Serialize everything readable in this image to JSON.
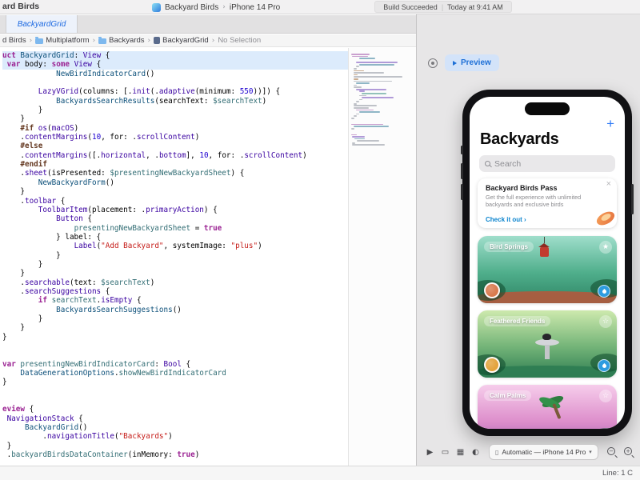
{
  "window": {
    "title": "ard Birds"
  },
  "toolbar": {
    "scheme": {
      "app": "Backyard Birds",
      "separator": "›",
      "device": "iPhone 14 Pro"
    },
    "status": {
      "build": "Build Succeeded",
      "divider": "|",
      "time": "Today at 9:41 AM"
    }
  },
  "tabs": [
    {
      "label": "BackyardGrid"
    }
  ],
  "breadcrumb": {
    "separator": "›",
    "items": [
      "d Birds",
      "Multiplatform",
      "Backyards",
      "BackyardGrid",
      "No Selection"
    ]
  },
  "editor": {
    "highlighted_lines": [
      0,
      1
    ],
    "code": [
      [
        [
          "k",
          "uct"
        ],
        [
          "p",
          " "
        ],
        [
          "ty",
          "BackyardGrid"
        ],
        [
          "p",
          ": "
        ],
        [
          "fw",
          "View"
        ],
        [
          "p",
          " {"
        ]
      ],
      [
        [
          "p",
          " "
        ],
        [
          "k",
          "var"
        ],
        [
          "p",
          " body: "
        ],
        [
          "k",
          "some"
        ],
        [
          "p",
          " "
        ],
        [
          "fw",
          "View"
        ],
        [
          "p",
          " {"
        ]
      ],
      [
        [
          "p",
          "            "
        ],
        [
          "ty",
          "NewBirdIndicatorCard"
        ],
        [
          "p",
          "()"
        ]
      ],
      [],
      [
        [
          "p",
          "        "
        ],
        [
          "fw",
          "LazyVGrid"
        ],
        [
          "p",
          "(columns: [."
        ],
        [
          "fw",
          "init"
        ],
        [
          "p",
          "(."
        ],
        [
          "fw",
          "adaptive"
        ],
        [
          "p",
          "(minimum: "
        ],
        [
          "n",
          "550"
        ],
        [
          "p",
          "))]) {"
        ]
      ],
      [
        [
          "p",
          "            "
        ],
        [
          "ty",
          "BackyardsSearchResults"
        ],
        [
          "p",
          "(searchText: "
        ],
        [
          "v",
          "$searchText"
        ],
        [
          "p",
          ")"
        ]
      ],
      [
        [
          "p",
          "        }"
        ]
      ],
      [
        [
          "p",
          "    }"
        ]
      ],
      [
        [
          "p",
          "    "
        ],
        [
          "pp",
          "#if"
        ],
        [
          "p",
          " "
        ],
        [
          "fw",
          "os"
        ],
        [
          "p",
          "("
        ],
        [
          "fw",
          "macOS"
        ],
        [
          "p",
          ")"
        ]
      ],
      [
        [
          "p",
          "    ."
        ],
        [
          "fw",
          "contentMargins"
        ],
        [
          "p",
          "("
        ],
        [
          "n",
          "10"
        ],
        [
          "p",
          ", for: ."
        ],
        [
          "fw",
          "scrollContent"
        ],
        [
          "p",
          ")"
        ]
      ],
      [
        [
          "p",
          "    "
        ],
        [
          "pp",
          "#else"
        ]
      ],
      [
        [
          "p",
          "    ."
        ],
        [
          "fw",
          "contentMargins"
        ],
        [
          "p",
          "([."
        ],
        [
          "fw",
          "horizontal"
        ],
        [
          "p",
          ", ."
        ],
        [
          "fw",
          "bottom"
        ],
        [
          "p",
          "], "
        ],
        [
          "n",
          "10"
        ],
        [
          "p",
          ", for: ."
        ],
        [
          "fw",
          "scrollContent"
        ],
        [
          "p",
          ")"
        ]
      ],
      [
        [
          "p",
          "    "
        ],
        [
          "pp",
          "#endif"
        ]
      ],
      [
        [
          "p",
          "    ."
        ],
        [
          "fw",
          "sheet"
        ],
        [
          "p",
          "(isPresented: "
        ],
        [
          "v",
          "$presentingNewBackyardSheet"
        ],
        [
          "p",
          ") {"
        ]
      ],
      [
        [
          "p",
          "        "
        ],
        [
          "ty",
          "NewBackyardForm"
        ],
        [
          "p",
          "()"
        ]
      ],
      [
        [
          "p",
          "    }"
        ]
      ],
      [
        [
          "p",
          "    ."
        ],
        [
          "fw",
          "toolbar"
        ],
        [
          "p",
          " {"
        ]
      ],
      [
        [
          "p",
          "        "
        ],
        [
          "fw",
          "ToolbarItem"
        ],
        [
          "p",
          "(placement: ."
        ],
        [
          "fw",
          "primaryAction"
        ],
        [
          "p",
          ") {"
        ]
      ],
      [
        [
          "p",
          "            "
        ],
        [
          "fw",
          "Button"
        ],
        [
          "p",
          " {"
        ]
      ],
      [
        [
          "p",
          "                "
        ],
        [
          "v",
          "presentingNewBackyardSheet"
        ],
        [
          "p",
          " = "
        ],
        [
          "k",
          "true"
        ]
      ],
      [
        [
          "p",
          "            } label: {"
        ]
      ],
      [
        [
          "p",
          "                "
        ],
        [
          "fw",
          "Label"
        ],
        [
          "p",
          "("
        ],
        [
          "s",
          "\"Add Backyard\""
        ],
        [
          "p",
          ", systemImage: "
        ],
        [
          "s",
          "\"plus\""
        ],
        [
          "p",
          ")"
        ]
      ],
      [
        [
          "p",
          "            }"
        ]
      ],
      [
        [
          "p",
          "        }"
        ]
      ],
      [
        [
          "p",
          "    }"
        ]
      ],
      [
        [
          "p",
          "    ."
        ],
        [
          "fw",
          "searchable"
        ],
        [
          "p",
          "(text: "
        ],
        [
          "v",
          "$searchText"
        ],
        [
          "p",
          ")"
        ]
      ],
      [
        [
          "p",
          "    ."
        ],
        [
          "fw",
          "searchSuggestions"
        ],
        [
          "p",
          " {"
        ]
      ],
      [
        [
          "p",
          "        "
        ],
        [
          "k",
          "if"
        ],
        [
          "p",
          " "
        ],
        [
          "v",
          "searchText"
        ],
        [
          "p",
          "."
        ],
        [
          "fw",
          "isEmpty"
        ],
        [
          "p",
          " {"
        ]
      ],
      [
        [
          "p",
          "            "
        ],
        [
          "ty",
          "BackyardsSearchSuggestions"
        ],
        [
          "p",
          "()"
        ]
      ],
      [
        [
          "p",
          "        }"
        ]
      ],
      [
        [
          "p",
          "    }"
        ]
      ],
      [
        [
          "p",
          "}"
        ]
      ],
      [],
      [],
      [
        [
          "k",
          "var"
        ],
        [
          "p",
          " "
        ],
        [
          "v",
          "presentingNewBirdIndicatorCard"
        ],
        [
          "p",
          ": "
        ],
        [
          "fw",
          "Bool"
        ],
        [
          "p",
          " {"
        ]
      ],
      [
        [
          "p",
          "    "
        ],
        [
          "ty",
          "DataGenerationOptions"
        ],
        [
          "p",
          "."
        ],
        [
          "v",
          "showNewBirdIndicatorCard"
        ]
      ],
      [
        [
          "p",
          "}"
        ]
      ],
      [],
      [],
      [
        [
          "k",
          "eview"
        ],
        [
          "p",
          " {"
        ]
      ],
      [
        [
          "p",
          " "
        ],
        [
          "fw",
          "NavigationStack"
        ],
        [
          "p",
          " {"
        ]
      ],
      [
        [
          "p",
          "     "
        ],
        [
          "ty",
          "BackyardGrid"
        ],
        [
          "p",
          "()"
        ]
      ],
      [
        [
          "p",
          "         ."
        ],
        [
          "fw",
          "navigationTitle"
        ],
        [
          "p",
          "("
        ],
        [
          "s",
          "\"Backyards\""
        ],
        [
          "p",
          ")"
        ]
      ],
      [
        [
          "p",
          " }"
        ]
      ],
      [
        [
          "p",
          " ."
        ],
        [
          "v",
          "backyardBirdsDataContainer"
        ],
        [
          "p",
          "(inMemory: "
        ],
        [
          "k",
          "true"
        ],
        [
          "p",
          ")"
        ]
      ]
    ]
  },
  "canvas": {
    "preview_button": "Preview",
    "device_bar": {
      "icons": [
        {
          "name": "live-preview-icon",
          "glyph": "▶"
        },
        {
          "name": "device-frame-icon",
          "glyph": "▭"
        },
        {
          "name": "variants-icon",
          "glyph": "▦"
        },
        {
          "name": "color-scheme-icon",
          "glyph": "◐"
        }
      ],
      "device_glyph": "▯",
      "label": "Automatic — iPhone 14 Pro",
      "chevron": "▾",
      "zoom": [
        {
          "name": "zoom-out-button",
          "glyph": "−"
        },
        {
          "name": "zoom-in-button",
          "glyph": "+"
        }
      ]
    },
    "phone": {
      "nav_title": "Backyards",
      "add_button": "+",
      "search_placeholder": "Search",
      "promo": {
        "title": "Backyard Birds Pass",
        "body": "Get the full experience with unlimited backyards and exclusive birds",
        "cta": "Check it out ›",
        "close": "×"
      },
      "cards": [
        {
          "name": "Bird Springs",
          "scene": "springs",
          "star": "★",
          "colors": [
            "#9fdecb",
            "#4fae8b",
            "#2f8565"
          ],
          "ground": "#b05a3e",
          "badge": "#d97a4e"
        },
        {
          "name": "Feathered Friends",
          "scene": "bath",
          "star": "☆",
          "colors": [
            "#cde9ad",
            "#72b377",
            "#2e7d52"
          ],
          "ground": "#2e7d52",
          "badge": "#e3a33c"
        },
        {
          "name": "Calm Palms",
          "scene": "palms",
          "star": "☆",
          "colors": [
            "#f6cdeb",
            "#dd8ecb",
            "#a05fb0"
          ],
          "ground": "#8e4f9e",
          "badge": "#5a9ede"
        }
      ]
    }
  },
  "statusbar": {
    "line_info": "Line: 1 C"
  },
  "colors": {
    "accent": "#1d6fd6"
  }
}
